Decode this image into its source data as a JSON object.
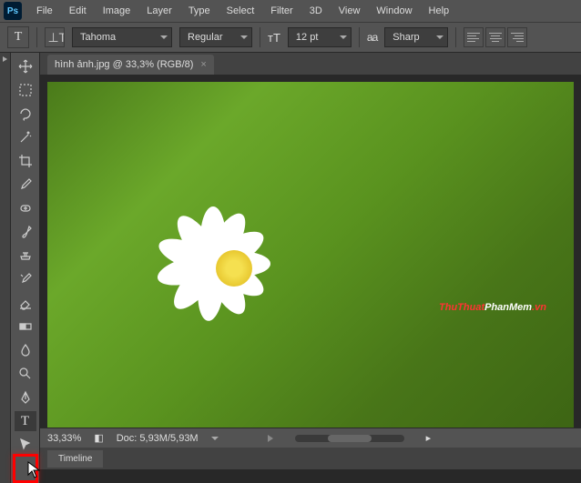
{
  "menu": {
    "items": [
      "File",
      "Edit",
      "Image",
      "Layer",
      "Type",
      "Select",
      "Filter",
      "3D",
      "View",
      "Window",
      "Help"
    ]
  },
  "optbar": {
    "tool_indicator": "T",
    "font_family": "Tahoma",
    "font_style": "Regular",
    "font_size": "12 pt",
    "antialias_label": "aa",
    "antialias": "Sharp"
  },
  "document": {
    "tab_title": "hình ảnh.jpg @ 33,3% (RGB/8)"
  },
  "watermark": {
    "part1": "ThuThuat",
    "part2": "PhanMem",
    "part3": ".vn"
  },
  "status": {
    "zoom": "33,33%",
    "doc_info": "Doc: 5,93M/5,93M"
  },
  "panels": {
    "timeline": "Timeline"
  },
  "tools": [
    "move-tool",
    "marquee-tool",
    "lasso-tool",
    "magic-wand-tool",
    "crop-tool",
    "eyedropper-tool",
    "healing-brush-tool",
    "brush-tool",
    "clone-stamp-tool",
    "history-brush-tool",
    "eraser-tool",
    "gradient-tool",
    "blur-tool",
    "dodge-tool",
    "pen-tool",
    "type-tool",
    "path-selection-tool"
  ]
}
